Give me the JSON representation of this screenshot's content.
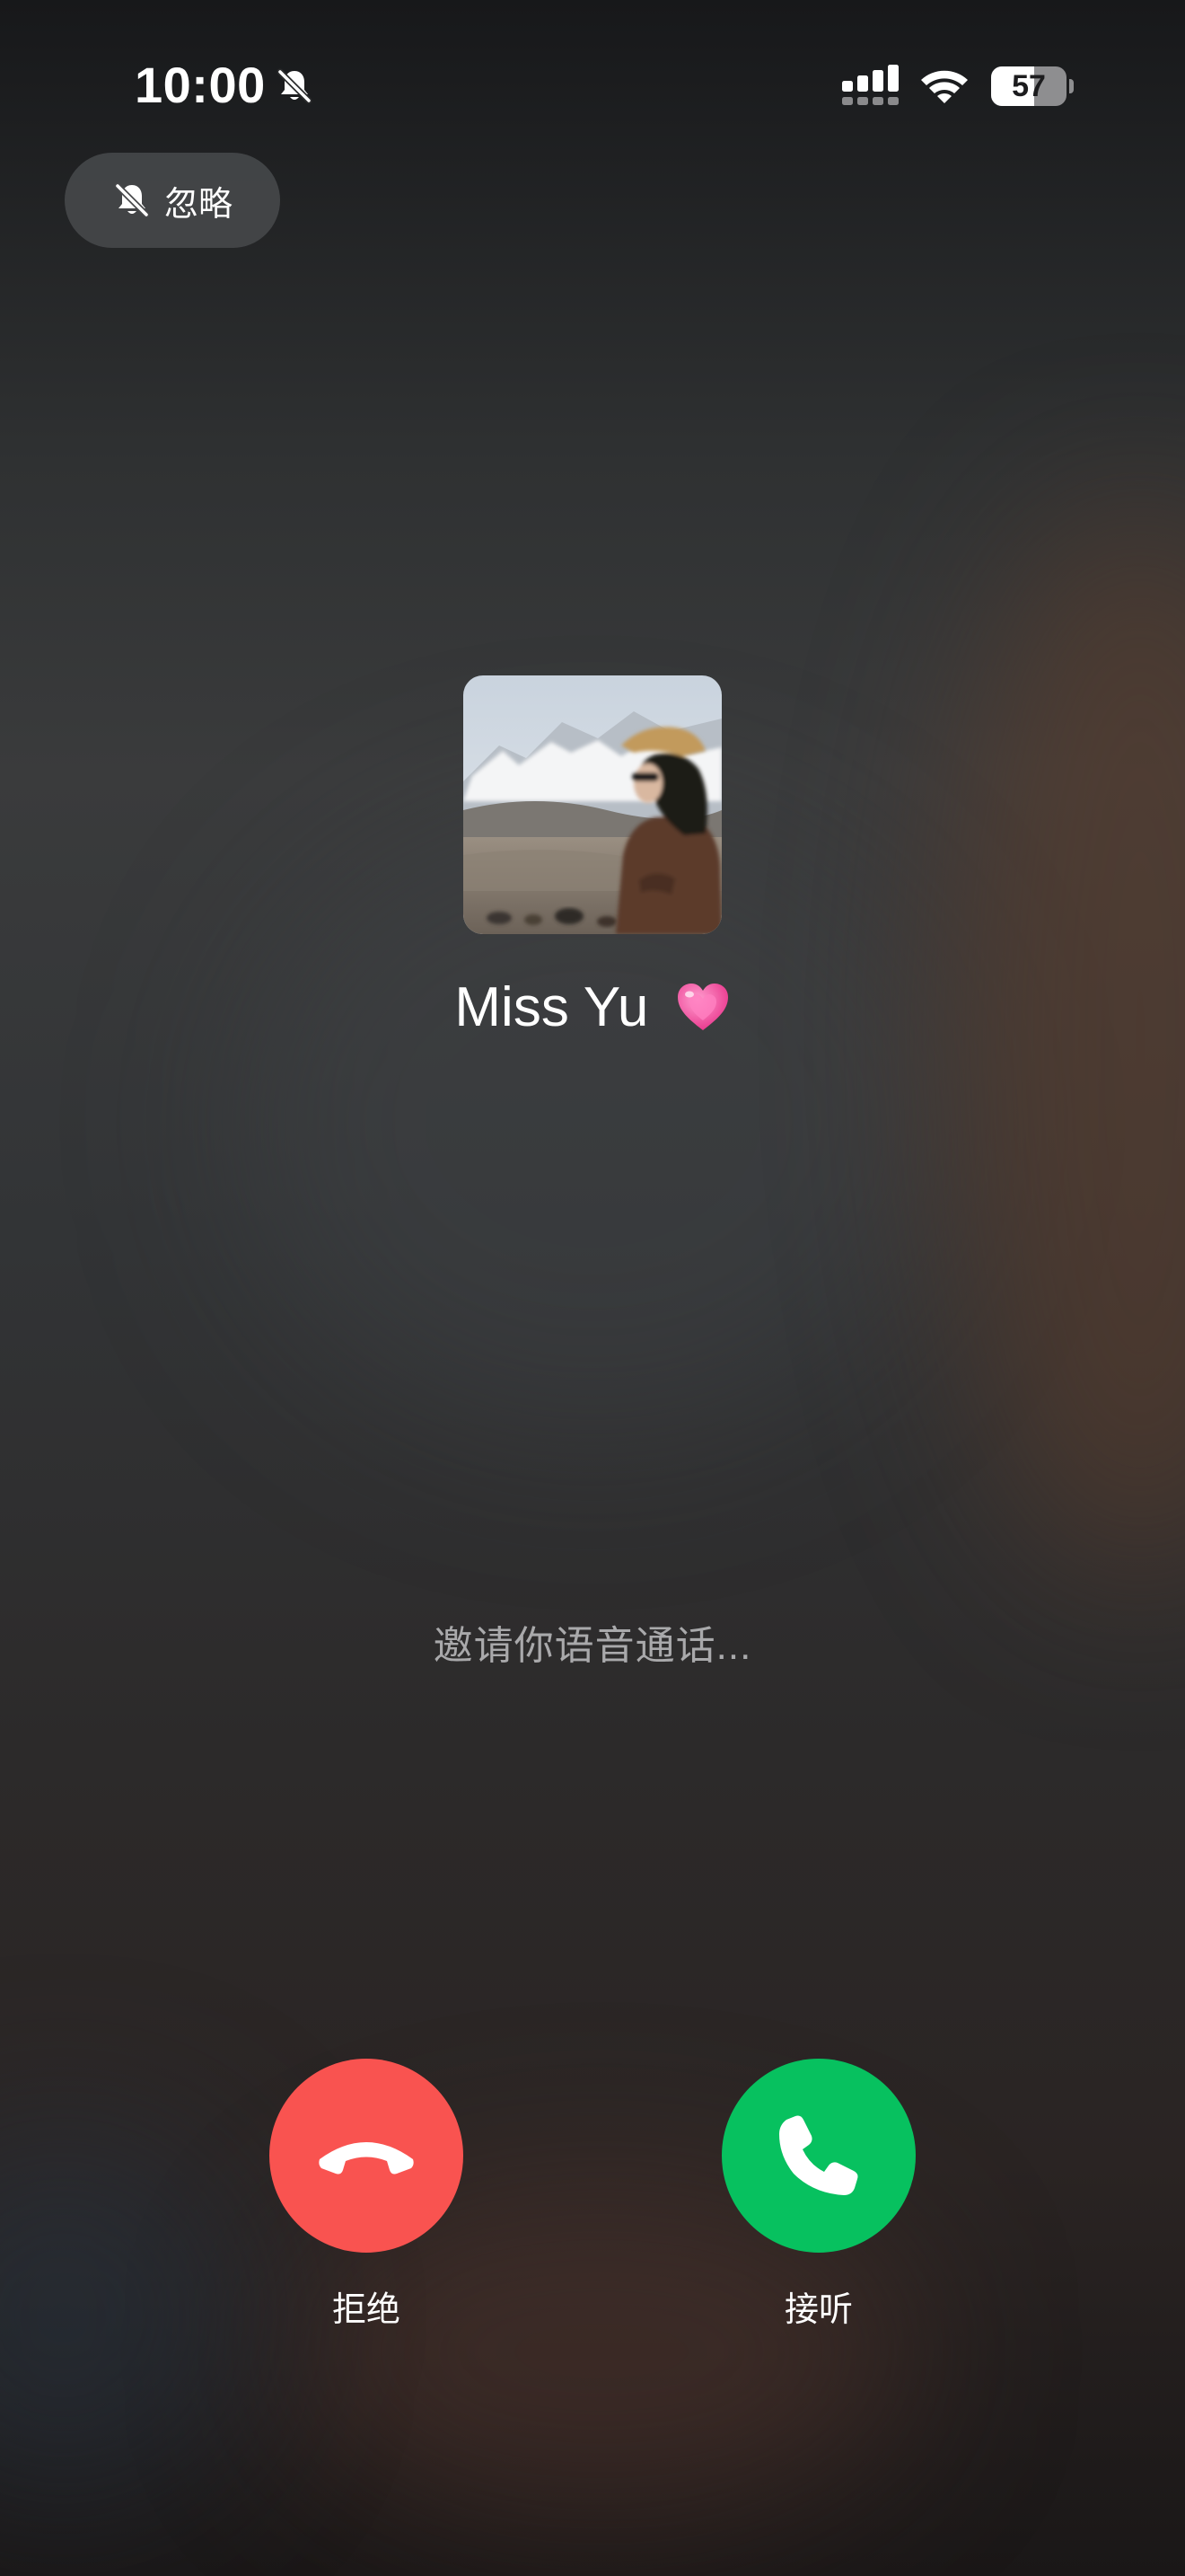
{
  "status_bar": {
    "time": "10:00",
    "battery_level": "57",
    "battery_fraction": 0.57,
    "signal_icon": "cellular-signal-icon",
    "wifi_icon": "wifi-icon",
    "silent_icon": "bell-slash-icon"
  },
  "ignore_button": {
    "label": "忽略",
    "icon": "bell-slash-icon"
  },
  "caller": {
    "name": "Miss Yu",
    "emoji_icon": "pink-heart-icon",
    "avatar": "caller-avatar-photo"
  },
  "call": {
    "status_text": "邀请你语音通话..."
  },
  "actions": {
    "decline_label": "拒绝",
    "accept_label": "接听",
    "decline_color": "#f95350",
    "accept_color": "#07c15f"
  }
}
